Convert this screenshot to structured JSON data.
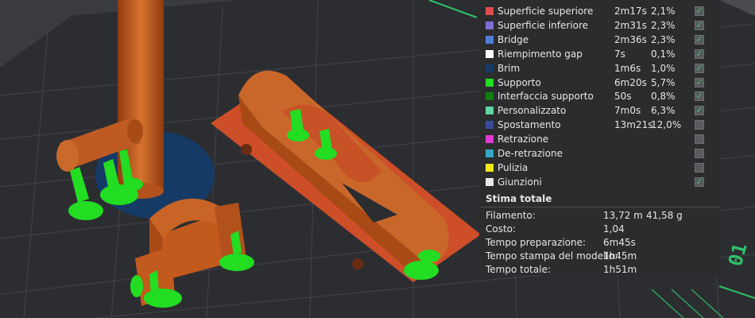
{
  "legend": {
    "rows": [
      {
        "label": "Superficie superiore",
        "time": "2m17s",
        "percent": "2,1%",
        "color": "#e04b4b",
        "checked": true
      },
      {
        "label": "Superficie inferiore",
        "time": "2m31s",
        "percent": "2,3%",
        "color": "#7b6fd1",
        "checked": true
      },
      {
        "label": "Bridge",
        "time": "2m36s",
        "percent": "2,3%",
        "color": "#4f7ed8",
        "checked": true
      },
      {
        "label": "Riempimento gap",
        "time": "7s",
        "percent": "0,1%",
        "color": "#ffffff",
        "checked": true
      },
      {
        "label": "Brim",
        "time": "1m6s",
        "percent": "1,0%",
        "color": "#163a66",
        "checked": true
      },
      {
        "label": "Supporto",
        "time": "6m20s",
        "percent": "5,7%",
        "color": "#22dd22",
        "checked": true
      },
      {
        "label": "Interfaccia supporto",
        "time": "50s",
        "percent": "0,8%",
        "color": "#0e7f10",
        "checked": true
      },
      {
        "label": "Personalizzato",
        "time": "7m0s",
        "percent": "6,3%",
        "color": "#5ed6a0",
        "checked": true
      },
      {
        "label": "Spostamento",
        "time": "13m21s",
        "percent": "12,0%",
        "color": "#3a4a9a",
        "checked": false
      },
      {
        "label": "Retrazione",
        "time": "",
        "percent": "",
        "color": "#e03ad1",
        "checked": false
      },
      {
        "label": "De-retrazione",
        "time": "",
        "percent": "",
        "color": "#34a6c4",
        "checked": false
      },
      {
        "label": "Pulizia",
        "time": "",
        "percent": "",
        "color": "#f2e51a",
        "checked": false
      },
      {
        "label": "Giunzioni",
        "time": "",
        "percent": "",
        "color": "#e9e9e9",
        "checked": true
      }
    ]
  },
  "total": {
    "title": "Stima totale",
    "filament_label": "Filamento:",
    "filament_length": "13,72 m",
    "filament_weight": "41,58 g",
    "cost_label": "Costo:",
    "cost_value": "1,04",
    "prep_label": "Tempo preparazione:",
    "prep_value": "6m45s",
    "model_label": "Tempo stampa del modello:",
    "model_value": "1h45m",
    "total_label": "Tempo totale:",
    "total_value": "1h51m"
  },
  "colors": {
    "background": "#3a3b3f",
    "plate": "#2c2d31",
    "part": "#c15a1c",
    "part_stripe": "#d14a3c",
    "support": "#22dd22",
    "brim": "#163a66",
    "panel": "#2b2c2e",
    "plate_edge": "#2fbf6a"
  },
  "plate_marker": "01"
}
